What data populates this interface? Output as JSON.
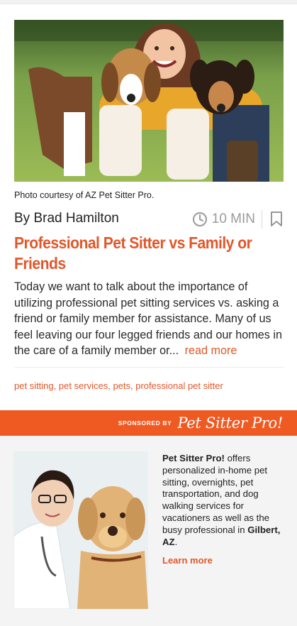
{
  "hero": {
    "icon": "hero-photo-woman-with-dogs"
  },
  "article": {
    "photo_caption": "Photo courtesy of AZ Pet Sitter Pro.",
    "byline": "By Brad Hamilton",
    "read_time": "10 MIN",
    "title": "Professional Pet Sitter vs Family or Friends",
    "excerpt": "Today we want to talk about the importance of utilizing professional pet sitting services vs. asking a friend or family member for assistance. Many of us feel leaving our four legged friends and our homes in the care of a family member or...",
    "read_more_label": "read more",
    "tags": "pet sitting, pet services, pets, professional pet sitter"
  },
  "sponsor": {
    "label": "SPONSORED BY",
    "logo_text": "Pet Sitter Pro!"
  },
  "promo": {
    "brand": "Pet Sitter Pro!",
    "description": " offers personalized in-home pet sitting, overnights, pet transportation, and dog walking services for vacationers as well as the busy professional in ",
    "location": "Gilbert, AZ",
    "period": ".",
    "learn_more_label": "Learn more"
  },
  "colors": {
    "accent": "#e2572a",
    "sponsor_bar": "#ef5a23",
    "muted": "#9a9a9a"
  }
}
